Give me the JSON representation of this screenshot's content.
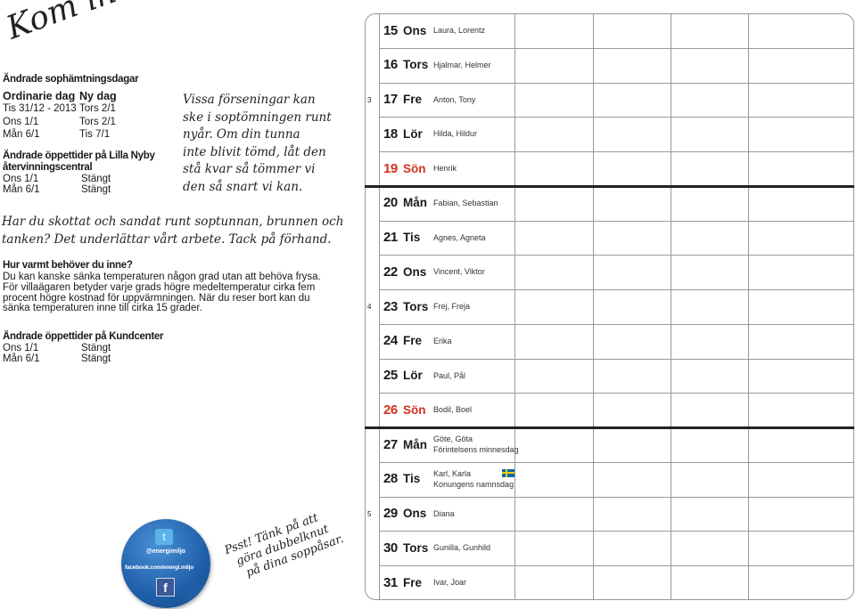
{
  "left": {
    "heading": "Kom ihåg!",
    "garbage": {
      "title": "Ändrade sophämtningsdagar",
      "col_headers": [
        "Ordinarie dag",
        "Ny dag"
      ],
      "rows": [
        [
          "Tis 31/12 - 2013",
          "Tors 2/1"
        ],
        [
          "Ons 1/1",
          "Tors 2/1"
        ],
        [
          "Mån 6/1",
          "Tis 7/1"
        ]
      ]
    },
    "recycling": {
      "title_line1": "Ändrade öppettider på Lilla Nyby",
      "title_line2": "återvinningscentral",
      "rows": [
        [
          "Ons 1/1",
          "Stängt"
        ],
        [
          "Mån 6/1",
          "Stängt"
        ]
      ]
    },
    "delay_note": [
      "Vissa förseningar kan",
      "ske i soptömningen runt",
      "nyår. Om din tunna",
      "inte blivit tömd, låt den",
      "stå kvar så tömmer vi",
      "den så snart vi kan."
    ],
    "shovel_note": [
      "Har du skottat och sandat runt soptunnan, brunnen och",
      "tanken? Det underlättar vårt arbete. Tack på förhand."
    ],
    "heating": {
      "title": "Hur varmt behöver du inne?",
      "body": [
        "Du kan kanske sänka temperaturen någon grad utan att behöva frysa.",
        "För villaägaren betyder varje grads högre medeltemperatur cirka fem",
        "procent högre kostnad för uppvärmningen. När du reser bort kan du",
        "sänka temperaturen inne till cirka 15 grader."
      ]
    },
    "kundcenter": {
      "title": "Ändrade öppettider på Kundcenter",
      "rows": [
        [
          "Ons 1/1",
          "Stängt"
        ],
        [
          "Mån 6/1",
          "Stängt"
        ]
      ]
    },
    "sticker": {
      "twitter": "@energimiljo",
      "facebook": "facebook.com/energi.miljo",
      "color": "#1f5fa8"
    },
    "psst_note": [
      "Psst! Tänk på att",
      "göra dubbelknut",
      "på dina soppåsar."
    ]
  },
  "calendar": {
    "sunday_color": "#d2321e",
    "days": [
      {
        "num": "15",
        "wd": "Ons",
        "names": "Laura, Lorentz"
      },
      {
        "num": "16",
        "wd": "Tors",
        "names": "Hjalmar, Helmer"
      },
      {
        "num": "17",
        "wd": "Fre",
        "names": "Anton, Tony",
        "week": "3"
      },
      {
        "num": "18",
        "wd": "Lör",
        "names": "Hilda, Hildur"
      },
      {
        "num": "19",
        "wd": "Sön",
        "names": "Henrik",
        "sunday": true
      },
      {
        "num": "20",
        "wd": "Mån",
        "names": "Fabian, Sebastian"
      },
      {
        "num": "21",
        "wd": "Tis",
        "names": "Agnes, Agneta"
      },
      {
        "num": "22",
        "wd": "Ons",
        "names": "Vincent, Viktor"
      },
      {
        "num": "23",
        "wd": "Tors",
        "names": "Frej, Freja",
        "week": "4"
      },
      {
        "num": "24",
        "wd": "Fre",
        "names": "Erika"
      },
      {
        "num": "25",
        "wd": "Lör",
        "names": "Paul, Pål"
      },
      {
        "num": "26",
        "wd": "Sön",
        "names": "Bodil, Boel",
        "sunday": true
      },
      {
        "num": "27",
        "wd": "Mån",
        "names": "Göte, Göta",
        "extra": "Förintelsens minnesdag"
      },
      {
        "num": "28",
        "wd": "Tis",
        "names": "Karl, Karla",
        "extra": "Konungens namnsdag",
        "flag": "swedish-flag"
      },
      {
        "num": "29",
        "wd": "Ons",
        "names": "Diana",
        "week": "5"
      },
      {
        "num": "30",
        "wd": "Tors",
        "names": "Gunilla, Gunhild"
      },
      {
        "num": "31",
        "wd": "Fre",
        "names": "Ivar, Joar"
      }
    ]
  }
}
